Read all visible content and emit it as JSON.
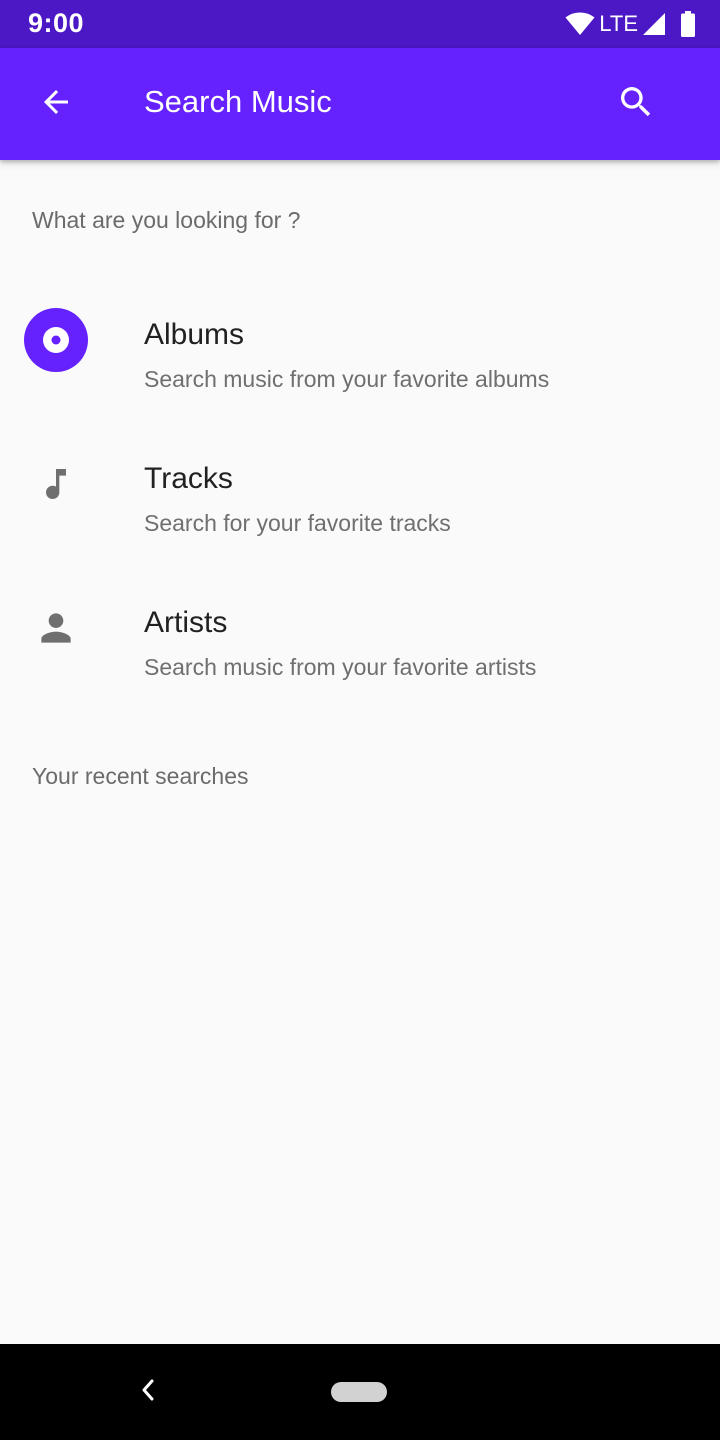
{
  "status_bar": {
    "time": "9:00",
    "network": "LTE",
    "icons": [
      "wifi-icon",
      "signal-icon",
      "battery-icon"
    ]
  },
  "app_bar": {
    "title": "Search Music",
    "back_icon": "arrow-back-icon",
    "search_icon": "search-icon",
    "color": "#6522ff"
  },
  "main": {
    "prompt": "What are you looking for ?",
    "categories": [
      {
        "icon": "album-icon",
        "title": "Albums",
        "subtitle": "Search music from your favorite albums",
        "selected": true
      },
      {
        "icon": "music-note-icon",
        "title": "Tracks",
        "subtitle": "Search for your favorite tracks",
        "selected": false
      },
      {
        "icon": "person-icon",
        "title": "Artists",
        "subtitle": "Search music from your favorite artists",
        "selected": false
      }
    ],
    "recent_header": "Your recent searches"
  },
  "colors": {
    "status_bar": "#4c17c4",
    "primary": "#6522ff",
    "icon_grey": "#6f6f6f",
    "background": "#fafafa"
  }
}
